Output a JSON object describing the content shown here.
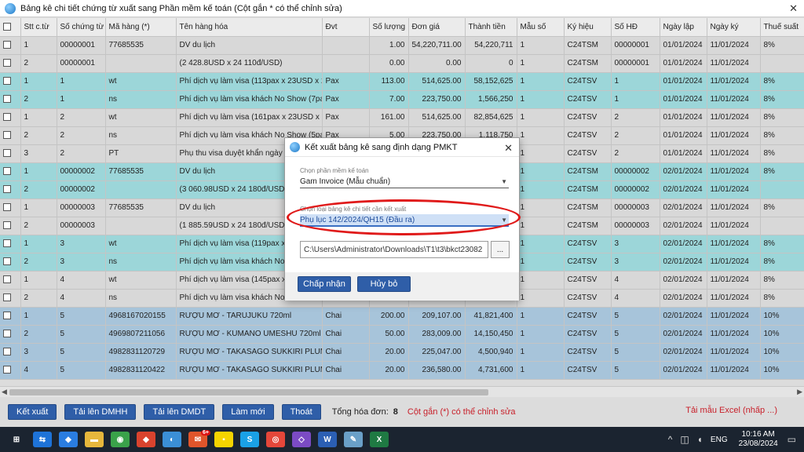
{
  "window": {
    "title": "Bảng kê chi tiết chứng từ xuất sang Phần mềm kế toán (Cột gắn * có thể chỉnh sửa)",
    "close_glyph": "✕"
  },
  "grid": {
    "columns": [
      "",
      "Stt c.từ",
      "Số chứng từ",
      "Mã hàng (*)",
      "Tên hàng hóa",
      "Đvt",
      "Số lượng",
      "Đơn giá",
      "Thành tiền",
      "Mẫu số",
      "Ký hiệu",
      "Số HĐ",
      "Ngày lập",
      "Ngày ký",
      "Thuế suất"
    ],
    "rows": [
      {
        "style": "r-gray",
        "cells": [
          "1",
          "00000001",
          "77685535",
          "DV du lịch",
          "",
          "1.00",
          "54,220,711.00",
          "54,220,711",
          "1",
          "C24TSM",
          "00000001",
          "01/01/2024",
          "11/01/2024",
          "8%"
        ]
      },
      {
        "style": "r-gray",
        "cells": [
          "2",
          "00000001",
          "",
          "(2 428.8USD x 24 110đ/USD)",
          "",
          "0.00",
          "0.00",
          "0",
          "1",
          "C24TSM",
          "00000001",
          "01/01/2024",
          "11/01/2024",
          ""
        ]
      },
      {
        "style": "r-teal",
        "cells": [
          "1",
          "1",
          "wt",
          "Phí dịch vụ làm visa (113pax x 23USD x 2",
          "Pax",
          "113.00",
          "514,625.00",
          "58,152,625",
          "1",
          "C24TSV",
          "1",
          "01/01/2024",
          "11/01/2024",
          "8%"
        ]
      },
      {
        "style": "r-teal",
        "cells": [
          "2",
          "1",
          "ns",
          "Phí dịch vụ làm visa khách No Show (7pa",
          "Pax",
          "7.00",
          "223,750.00",
          "1,566,250",
          "1",
          "C24TSV",
          "1",
          "01/01/2024",
          "11/01/2024",
          "8%"
        ]
      },
      {
        "style": "r-gray",
        "cells": [
          "1",
          "2",
          "wt",
          "Phí dịch vụ làm visa (161pax x 23USD x 2",
          "Pax",
          "161.00",
          "514,625.00",
          "82,854,625",
          "1",
          "C24TSV",
          "2",
          "01/01/2024",
          "11/01/2024",
          "8%"
        ]
      },
      {
        "style": "r-gray",
        "cells": [
          "2",
          "2",
          "ns",
          "Phí dịch vụ làm visa khách No Show (5pa",
          "Pax",
          "5.00",
          "223,750.00",
          "1,118,750",
          "1",
          "C24TSV",
          "2",
          "01/01/2024",
          "11/01/2024",
          "8%"
        ]
      },
      {
        "style": "r-gray",
        "cells": [
          "3",
          "2",
          "PT",
          "Phụ thu visa duyệt khẩn ngày n",
          "",
          "",
          "",
          "",
          "1",
          "C24TSV",
          "2",
          "01/01/2024",
          "11/01/2024",
          "8%"
        ]
      },
      {
        "style": "r-teal",
        "cells": [
          "1",
          "00000002",
          "77685535",
          "DV du lịch",
          "",
          "",
          "",
          "",
          "1",
          "C24TSM",
          "00000002",
          "02/01/2024",
          "11/01/2024",
          "8%"
        ]
      },
      {
        "style": "r-teal",
        "cells": [
          "2",
          "00000002",
          "",
          "(3 060.98USD x 24 180đ/USD)",
          "",
          "",
          "",
          "",
          "1",
          "C24TSM",
          "00000002",
          "02/01/2024",
          "11/01/2024",
          ""
        ]
      },
      {
        "style": "r-gray",
        "cells": [
          "1",
          "00000003",
          "77685535",
          "DV du lịch",
          "",
          "",
          "",
          "",
          "1",
          "C24TSM",
          "00000003",
          "02/01/2024",
          "11/01/2024",
          "8%"
        ]
      },
      {
        "style": "r-gray",
        "cells": [
          "2",
          "00000003",
          "",
          "(1 885.59USD x 24 180đ/USD)",
          "",
          "",
          "",
          "",
          "1",
          "C24TSM",
          "00000003",
          "02/01/2024",
          "11/01/2024",
          ""
        ]
      },
      {
        "style": "r-teal",
        "cells": [
          "1",
          "3",
          "wt",
          "Phí dịch vụ làm visa (119pax x 2",
          "",
          "",
          "",
          "",
          "1",
          "C24TSV",
          "3",
          "02/01/2024",
          "11/01/2024",
          "8%"
        ]
      },
      {
        "style": "r-teal",
        "cells": [
          "2",
          "3",
          "ns",
          "Phí dịch vụ làm visa khách No S",
          "",
          "",
          "",
          "",
          "1",
          "C24TSV",
          "3",
          "02/01/2024",
          "11/01/2024",
          "8%"
        ]
      },
      {
        "style": "r-gray",
        "cells": [
          "1",
          "4",
          "wt",
          "Phí dịch vụ làm visa (145pax x 2",
          "",
          "",
          "",
          "",
          "1",
          "C24TSV",
          "4",
          "02/01/2024",
          "11/01/2024",
          "8%"
        ]
      },
      {
        "style": "r-gray",
        "cells": [
          "2",
          "4",
          "ns",
          "Phí dịch vụ làm visa khách No",
          "",
          "",
          "",
          "",
          "1",
          "C24TSV",
          "4",
          "02/01/2024",
          "11/01/2024",
          "8%"
        ]
      },
      {
        "style": "r-blue",
        "cells": [
          "1",
          "5",
          "4968167020155",
          "RƯỢU MƠ - TARUJUKU 720ml",
          "Chai",
          "200.00",
          "209,107.00",
          "41,821,400",
          "1",
          "C24TSV",
          "5",
          "02/01/2024",
          "11/01/2024",
          "10%"
        ]
      },
      {
        "style": "r-blue",
        "cells": [
          "2",
          "5",
          "4969807211056",
          "RƯỢU MƠ - KUMANO UMESHU 720ml",
          "Chai",
          "50.00",
          "283,009.00",
          "14,150,450",
          "1",
          "C24TSV",
          "5",
          "02/01/2024",
          "11/01/2024",
          "10%"
        ]
      },
      {
        "style": "r-blue",
        "cells": [
          "3",
          "5",
          "4982831120729",
          "RƯỢU MƠ - TAKASAGO SUKKIRI PLUM S",
          "Chai",
          "20.00",
          "225,047.00",
          "4,500,940",
          "1",
          "C24TSV",
          "5",
          "02/01/2024",
          "11/01/2024",
          "10%"
        ]
      },
      {
        "style": "r-blue",
        "cells": [
          "4",
          "5",
          "4982831120422",
          "RƯỢU MƠ - TAKASAGO SUKKIRI PLUM S",
          "Chai",
          "20.00",
          "236,580.00",
          "4,731,600",
          "1",
          "C24TSV",
          "5",
          "02/01/2024",
          "11/01/2024",
          "10%"
        ]
      }
    ]
  },
  "scrollbar": {
    "left_glyph": "◀",
    "right_glyph": "▶"
  },
  "footer": {
    "buttons": [
      "Kết xuất",
      "Tải lên DMHH",
      "Tải lên DMDT",
      "Làm mới",
      "Thoát"
    ],
    "total_label": "Tổng hóa đơn:",
    "total_value": "8",
    "hint": "Cột gắn (*) có thể chỉnh sửa",
    "template_link": "Tải mẫu Excel (nhấp ...)"
  },
  "dialog": {
    "title": "Kết xuất bảng kê sang định dạng PMKT",
    "close_glyph": "✕",
    "software_label": "Chọn phần mềm kế toán",
    "software_value": "Gam Invoice (Mẫu chuẩn)",
    "detail_label": "Chọn loại bảng kê chi tiết cần kết xuất",
    "detail_value": "Phụ lục 142/2024/QH15 (Đầu ra)",
    "path_value": "C:\\Users\\Administrator\\Downloads\\T1\\t3\\bkct23082",
    "browse_label": "...",
    "accept_label": "Chấp nhận",
    "cancel_label": "Hủy bỏ",
    "caret_glyph": "▼"
  },
  "taskbar": {
    "icons": [
      {
        "name": "windows-start-icon",
        "glyph": "⊞",
        "color": "#1b2430"
      },
      {
        "name": "teamviewer-icon",
        "glyph": "⇆",
        "color": "#1e73d8"
      },
      {
        "name": "dropbox-icon",
        "glyph": "◆",
        "color": "#2a7de1"
      },
      {
        "name": "file-explorer-icon",
        "glyph": "▬",
        "color": "#e6b73c"
      },
      {
        "name": "app-green-icon",
        "glyph": "◉",
        "color": "#3aa24a"
      },
      {
        "name": "app-red-icon",
        "glyph": "◆",
        "color": "#d9432e"
      },
      {
        "name": "invoice-app-icon",
        "glyph": "◐",
        "color": "#3b8fd6"
      },
      {
        "name": "chat-app-icon",
        "glyph": "✉",
        "color": "#e0552b"
      },
      {
        "name": "sticky-notes-icon",
        "glyph": "▪",
        "color": "#f5d400"
      },
      {
        "name": "skype-icon",
        "glyph": "S",
        "color": "#1aa1e6"
      },
      {
        "name": "chrome-icon",
        "glyph": "◎",
        "color": "#e4473a"
      },
      {
        "name": "visual-studio-icon",
        "glyph": "◇",
        "color": "#7b4bc4"
      },
      {
        "name": "word-icon",
        "glyph": "W",
        "color": "#2b5fb4"
      },
      {
        "name": "paint-icon",
        "glyph": "✎",
        "color": "#6aa0c8"
      },
      {
        "name": "excel-icon",
        "glyph": "X",
        "color": "#1f7a43"
      }
    ],
    "chat_badge": "6+",
    "lang": "ENG",
    "time": "10:16 AM",
    "date": "23/08/2024"
  },
  "colors": {
    "accent": "#2f5ea8",
    "highlight_red": "#e01a1a",
    "row_teal": "#9cd6d9",
    "row_blue": "#a7c4da"
  }
}
